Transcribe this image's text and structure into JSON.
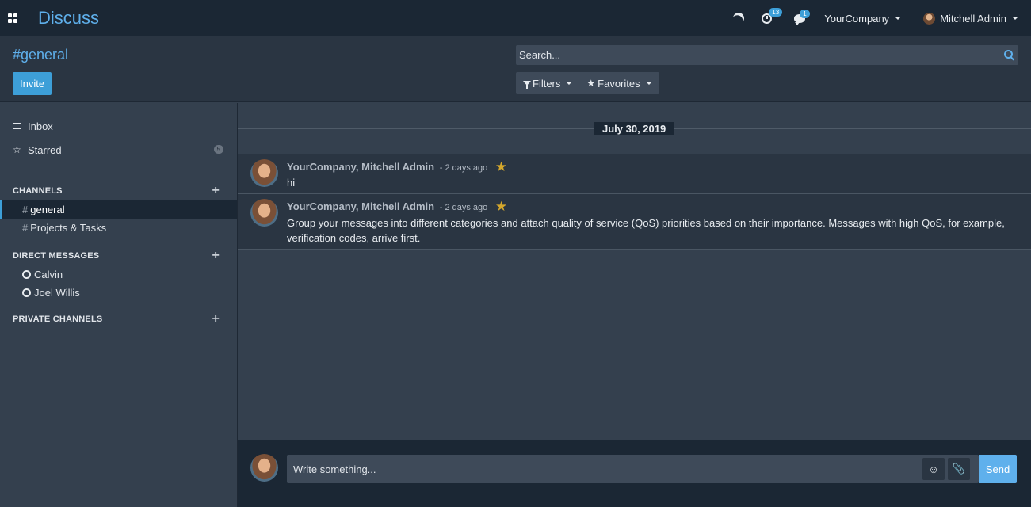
{
  "app": {
    "title": "Discuss"
  },
  "topbar": {
    "activity_count": "13",
    "messages_count": "1",
    "company": "YourCompany",
    "user_name": "Mitchell Admin"
  },
  "control": {
    "title": "#general",
    "invite_label": "Invite",
    "search_placeholder": "Search...",
    "filters_label": "Filters",
    "favorites_label": "Favorites"
  },
  "sidebar": {
    "inbox_label": "Inbox",
    "starred_label": "Starred",
    "starred_count": "5",
    "channels_header": "CHANNELS",
    "channels": [
      {
        "hash": "#",
        "name": "general"
      },
      {
        "hash": "#",
        "name": "Projects & Tasks"
      }
    ],
    "direct_header": "DIRECT MESSAGES",
    "direct": [
      {
        "name": "Calvin"
      },
      {
        "name": "Joel Willis"
      }
    ],
    "private_header": "PRIVATE CHANNELS"
  },
  "thread": {
    "date": "July 30, 2019",
    "messages": [
      {
        "author": "YourCompany, Mitchell Admin",
        "ago": "- 2 days ago",
        "body": "hi"
      },
      {
        "author": "YourCompany, Mitchell Admin",
        "ago": "- 2 days ago",
        "body": "Group your messages into different categories and attach quality of service (QoS) priorities based on their importance. Messages with high QoS, for example, verification codes, arrive first."
      }
    ]
  },
  "composer": {
    "placeholder": "Write something...",
    "emoji_glyph": "☺",
    "attach_glyph": "📎",
    "send_label": "Send"
  }
}
